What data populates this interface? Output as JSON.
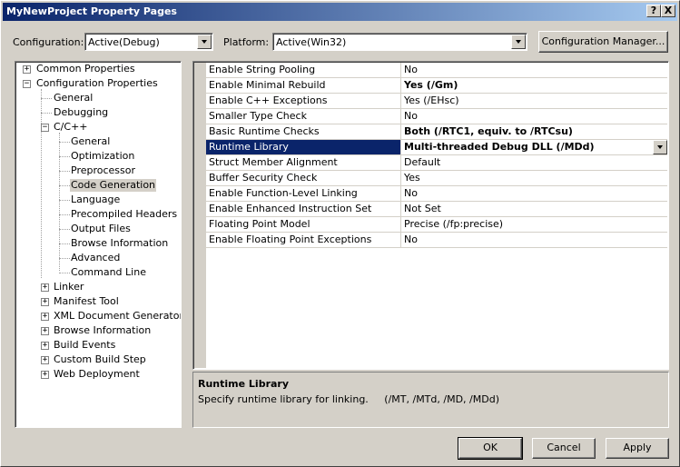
{
  "window": {
    "title": "MyNewProject Property Pages",
    "help_button": "?",
    "close_button": "X"
  },
  "toolbar": {
    "configuration_label": "Configuration:",
    "configuration_value": "Active(Debug)",
    "platform_label": "Platform:",
    "platform_value": "Active(Win32)",
    "configuration_manager_button": "Configuration Manager..."
  },
  "tree": {
    "common_properties": "Common Properties",
    "configuration_properties": "Configuration Properties",
    "general": "General",
    "debugging": "Debugging",
    "cpp": "C/C++",
    "cpp_children": [
      "General",
      "Optimization",
      "Preprocessor",
      "Code Generation",
      "Language",
      "Precompiled Headers",
      "Output Files",
      "Browse Information",
      "Advanced",
      "Command Line"
    ],
    "linker": "Linker",
    "manifest_tool": "Manifest Tool",
    "xml_document_generator": "XML Document Generator",
    "browse_information": "Browse Information",
    "build_events": "Build Events",
    "custom_build_step": "Custom Build Step",
    "web_deployment": "Web Deployment",
    "selected_item": "Code Generation"
  },
  "properties": [
    {
      "name": "Enable String Pooling",
      "value": "No"
    },
    {
      "name": "Enable Minimal Rebuild",
      "value": "Yes (/Gm)",
      "bold": true
    },
    {
      "name": "Enable C++ Exceptions",
      "value": "Yes (/EHsc)"
    },
    {
      "name": "Smaller Type Check",
      "value": "No"
    },
    {
      "name": "Basic Runtime Checks",
      "value": "Both (/RTC1, equiv. to /RTCsu)",
      "bold": true
    },
    {
      "name": "Runtime Library",
      "value": "Multi-threaded Debug DLL (/MDd)",
      "selected": true
    },
    {
      "name": "Struct Member Alignment",
      "value": "Default"
    },
    {
      "name": "Buffer Security Check",
      "value": "Yes"
    },
    {
      "name": "Enable Function-Level Linking",
      "value": "No"
    },
    {
      "name": "Enable Enhanced Instruction Set",
      "value": "Not Set"
    },
    {
      "name": "Floating Point Model",
      "value": "Precise (/fp:precise)"
    },
    {
      "name": "Enable Floating Point Exceptions",
      "value": "No"
    }
  ],
  "description": {
    "title": "Runtime Library",
    "text": "Specify runtime library for linking.     (/MT, /MTd, /MD, /MDd)"
  },
  "buttons": {
    "ok": "OK",
    "cancel": "Cancel",
    "apply": "Apply"
  },
  "colors": {
    "titlebar_start": "#0a246a",
    "titlebar_end": "#a6caf0",
    "selection": "#0a246a",
    "face": "#d4d0c8"
  }
}
